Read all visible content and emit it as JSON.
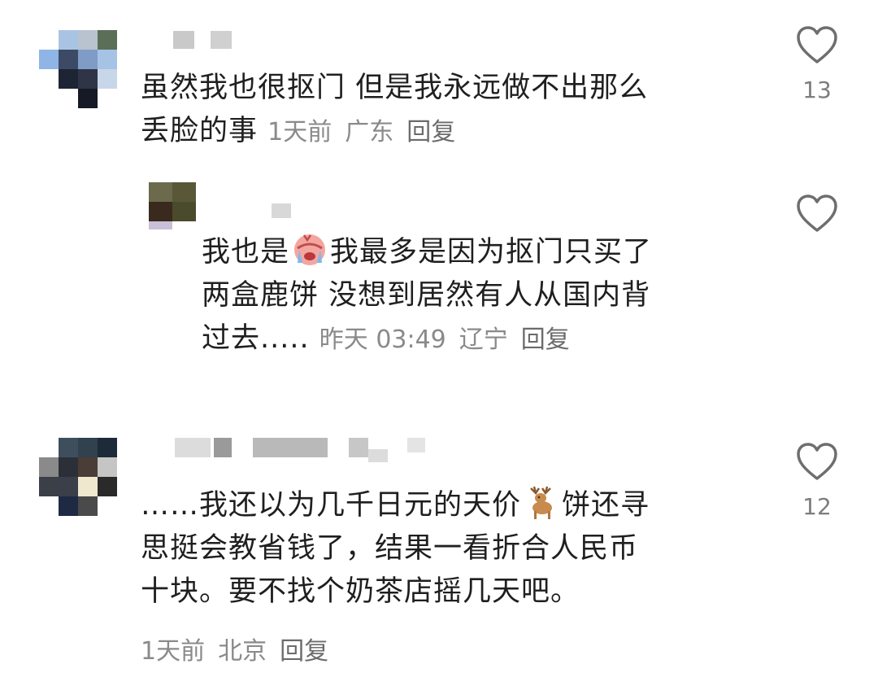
{
  "comments": [
    {
      "text_lines": [
        "虽然我也很抠门 但是我永远做不出那么",
        "丢脸的事"
      ],
      "time": "1天前",
      "location": "广东",
      "reply_label": "回复",
      "like_count": "13"
    },
    {
      "text_before": "我也是",
      "emoji": "crying-face",
      "text_after": "我最多是因为抠门只买了",
      "text_lines": [
        "两盒鹿饼 没想到居然有人从国内背",
        "过去....."
      ],
      "time": "昨天 03:49",
      "location": "辽宁",
      "reply_label": "回复"
    },
    {
      "text_start": "……我还以为几千日元的天价",
      "emoji": "deer",
      "text_mid": "饼还寻",
      "text_lines": [
        "思挺会教省钱了，结果一看折合人民币",
        "十块。要不找个奶茶店摇几天吧。"
      ],
      "time": "1天前",
      "location": "北京",
      "reply_label": "回复",
      "like_count": "12"
    }
  ],
  "icons": {
    "like": "heart-outline-icon"
  },
  "colors": {
    "text": "#1f1f1f",
    "meta": "#8a8a8a",
    "heart": "#6e6e6e"
  }
}
